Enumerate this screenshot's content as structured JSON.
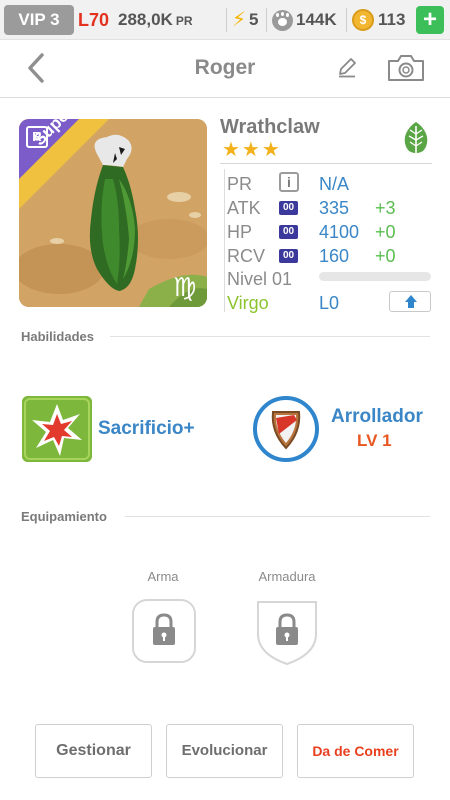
{
  "status": {
    "vip": "VIP 3",
    "level": "L70",
    "power": "288,0K",
    "power_unit": "PR",
    "energy": "5",
    "food": "144K",
    "coins": "113",
    "add": "+"
  },
  "header": {
    "title": "Roger"
  },
  "creature": {
    "rarity": "R",
    "tag": "Super",
    "name": "Wrathclaw",
    "stars": "★★★",
    "sign_glyph": "♍"
  },
  "stats": {
    "pr": {
      "label": "PR",
      "info": "i",
      "value": "N/A"
    },
    "atk": {
      "label": "ATK",
      "badge": "00",
      "value": "335",
      "bonus": "+3"
    },
    "hp": {
      "label": "HP",
      "badge": "00",
      "value": "4100",
      "bonus": "+0"
    },
    "rcv": {
      "label": "RCV",
      "badge": "00",
      "value": "160",
      "bonus": "+0"
    },
    "nivel": {
      "label": "Nivel 01",
      "progress": 0
    },
    "sign": {
      "label": "Virgo",
      "value": "L0"
    }
  },
  "skills": {
    "header": "Habilidades",
    "skill1": {
      "name": "Sacrificio+"
    },
    "skill2": {
      "name": "Arrollador",
      "level": "LV 1"
    }
  },
  "equipment": {
    "header": "Equipamiento",
    "weapon": "Arma",
    "armor": "Armadura"
  },
  "actions": {
    "manage": "Gestionar",
    "evolve": "Evolucionar",
    "feed": "Da de Comer"
  },
  "colors": {
    "accent_blue": "#3a86c6",
    "level_red": "#e3301f",
    "bonus_green": "#5bbd4f",
    "virgo_green": "#8bc42d",
    "feed_red": "#e8401f"
  }
}
